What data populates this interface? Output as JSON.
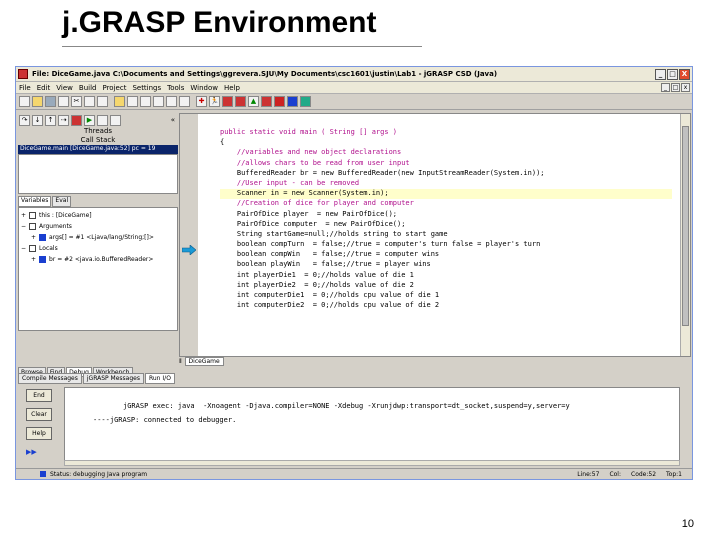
{
  "slide": {
    "title": "j.GRASP Environment",
    "page_number": "10"
  },
  "window": {
    "title": "File: DiceGame.java  C:\\Documents and Settings\\ggrevera.SJU\\My Documents\\csc1601\\justin\\Lab1 - jGRASP CSD (Java)",
    "buttons": [
      "_",
      "□",
      "X"
    ]
  },
  "menu": [
    "File",
    "Edit",
    "View",
    "Build",
    "Project",
    "Settings",
    "Tools",
    "Window",
    "Help"
  ],
  "mdi_buttons": [
    "_",
    "□",
    "x"
  ],
  "debug_panel": {
    "threads_label": "Threads",
    "call_stack_label": "Call Stack",
    "call_stack_row": "DiceGame.main [DiceGame.java:52] pc = 19",
    "tabs": [
      "Variables",
      "Eval"
    ],
    "variables": [
      {
        "name": "this : [DiceGame]"
      },
      {
        "name": "Arguments"
      },
      {
        "name": "args[] = #1 <Ljava/lang/String;[]>"
      },
      {
        "name": "Locals"
      },
      {
        "name": "br = #2 <java.io.BufferedReader>"
      }
    ],
    "bottom_tabs": [
      "Browse",
      "Find",
      "Debug",
      "Workbench"
    ]
  },
  "editor": {
    "tab": "DiceGame",
    "lines": [
      "public static void main ( String [] args )",
      "{",
      "    //variables and new object declarations",
      "    //allows chars to be read from user input",
      "    BufferedReader br = new BufferedReader(new InputStreamReader(System.in));",
      "    //User input - can be removed",
      "    Scanner in = new Scanner(System.in);",
      "    //Creation of dice for player and computer",
      "    PairOfDice player  = new PairOfDice();",
      "    PairOfDice computer  = new PairOfDice();",
      "    String startGame=null;//holds string to start game",
      "    boolean compTurn  = false;//true = computer's turn false = player's turn",
      "    boolean compWin   = false;//true = computer wins",
      "    boolean playWin   = false;//true = player wins",
      "    int playerDie1  = 0;//holds value of die 1",
      "    int playerDie2  = 0;//holds value of die 2",
      "    int computerDie1  = 0;//holds cpu value of die 1",
      "    int computerDie2  = 0;//holds cpu value of die 2"
    ]
  },
  "messages": {
    "tabs": [
      "Compile Messages",
      "jGRASP Messages",
      "Run I/O"
    ],
    "buttons": [
      "End",
      "Clear",
      "Help"
    ],
    "run_marker": "▶▶",
    "console": [
      "jGRASP exec: java  -Xnoagent -Djava.compiler=NONE -Xdebug -Xrunjdwp:transport=dt_socket,suspend=y,server=y",
      "----jGRASP: connected to debugger."
    ]
  },
  "status": {
    "text": "Status: debugging Java program",
    "line": "Line:57",
    "col": "Col:",
    "code": "Code:52",
    "top": "Top:1"
  }
}
